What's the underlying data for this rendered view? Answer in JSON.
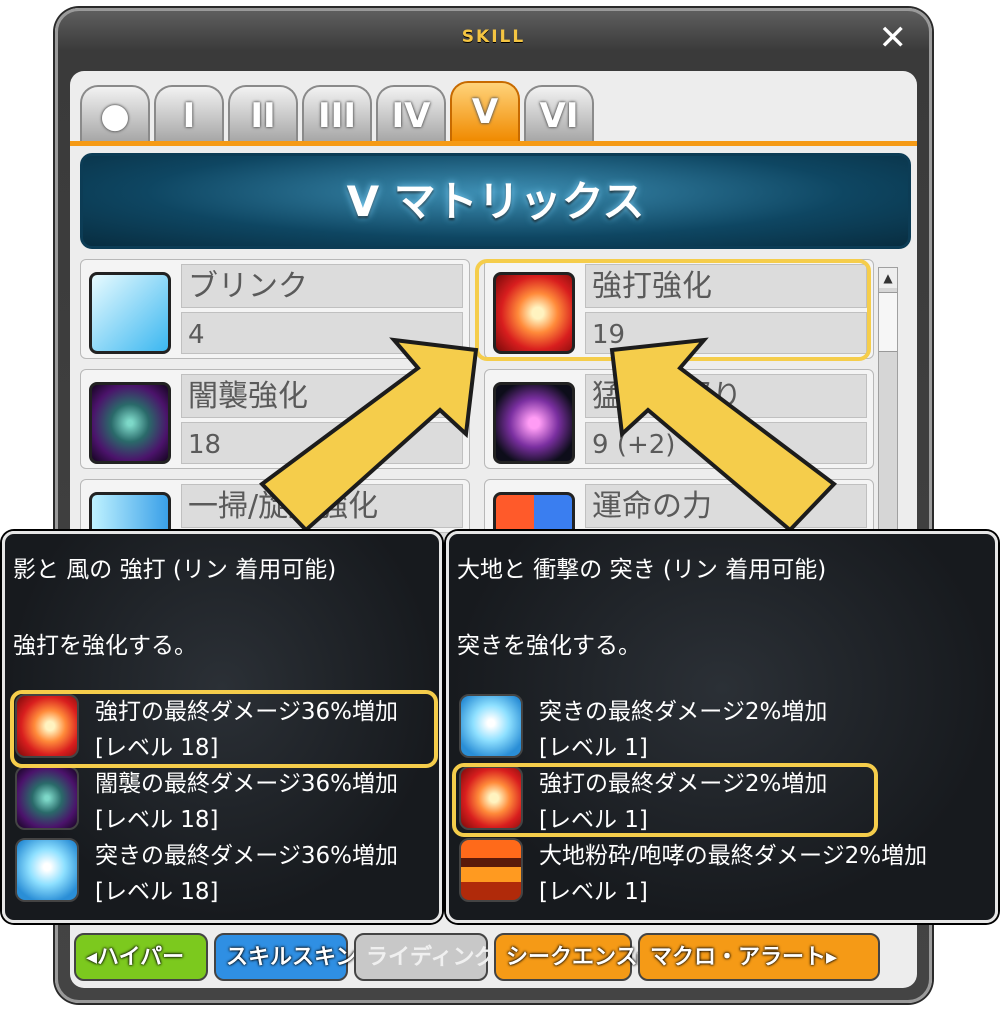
{
  "window": {
    "title": "SKILL",
    "close": "✕",
    "tabs": [
      "●",
      "I",
      "II",
      "III",
      "IV",
      "V",
      "VI"
    ],
    "active_tab": "V",
    "banner": "V マトリックス"
  },
  "skills": [
    {
      "name": "ブリンク",
      "level": "4",
      "icon": "blink-icon"
    },
    {
      "name": "強打強化",
      "level": "19",
      "icon": "strike-boost-icon"
    },
    {
      "name": "闇襲強化",
      "level": "18",
      "icon": "dark-raid-icon"
    },
    {
      "name": "猛獣の怒り",
      "level": "9 (+2)",
      "icon": "beast-fury-icon"
    },
    {
      "name": "一掃/旋風強化",
      "level": "",
      "icon": "sweep-icon"
    },
    {
      "name": "運命の力",
      "level": "",
      "icon": "fate-icon"
    }
  ],
  "buttons": [
    {
      "label": "◂ハイパー",
      "color": "#7cc91e"
    },
    {
      "label": "スキルスキン",
      "color": "#2f8fe3"
    },
    {
      "label": "ライディング",
      "color": "#c8c8c8"
    },
    {
      "label": "シークエンス▸",
      "color": "#f59a16"
    },
    {
      "label": "マクロ・アラート▸",
      "color": "#f59a16"
    }
  ],
  "tooltip_left": {
    "title": "影と 風の 強打 (リン 着用可能)",
    "desc": "強打を強化する。",
    "entries": [
      {
        "line1": "強打の最終ダメージ36%増加",
        "line2": "[レベル 18]",
        "icon": "strike-icon"
      },
      {
        "line1": "闇襲の最終ダメージ36%増加",
        "line2": "[レベル 18]",
        "icon": "dark-raid-icon"
      },
      {
        "line1": "突きの最終ダメージ36%増加",
        "line2": "[レベル 18]",
        "icon": "pierce-icon"
      }
    ]
  },
  "tooltip_right": {
    "title": "大地と 衝撃の 突き (リン 着用可能)",
    "desc": "突きを強化する。",
    "entries": [
      {
        "line1": "突きの最終ダメージ2%増加",
        "line2": "[レベル 1]",
        "icon": "pierce-icon"
      },
      {
        "line1": "強打の最終ダメージ2%増加",
        "line2": "[レベル 1]",
        "icon": "strike-icon"
      },
      {
        "line1": "大地粉砕/咆哮の最終ダメージ2%増加",
        "line2": "[レベル 1]",
        "icon": "earth-shatter-icon"
      }
    ]
  },
  "colors": {
    "highlight": "#f5cd4b",
    "arrow": "#f5cd4b",
    "tab_active": "#f59a16"
  }
}
